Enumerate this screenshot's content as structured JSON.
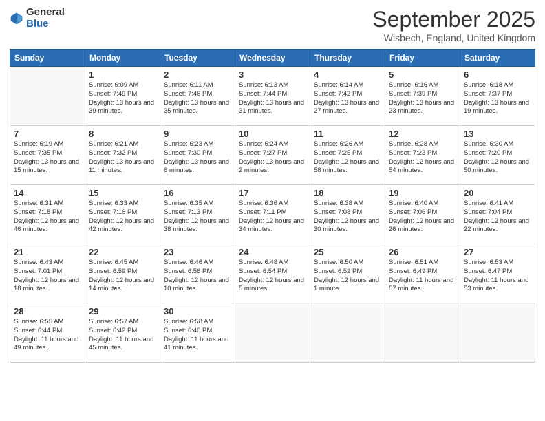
{
  "header": {
    "logo_general": "General",
    "logo_blue": "Blue",
    "month_title": "September 2025",
    "location": "Wisbech, England, United Kingdom"
  },
  "weekdays": [
    "Sunday",
    "Monday",
    "Tuesday",
    "Wednesday",
    "Thursday",
    "Friday",
    "Saturday"
  ],
  "weeks": [
    [
      {
        "day": "",
        "sunrise": "",
        "sunset": "",
        "daylight": ""
      },
      {
        "day": "1",
        "sunrise": "Sunrise: 6:09 AM",
        "sunset": "Sunset: 7:49 PM",
        "daylight": "Daylight: 13 hours and 39 minutes."
      },
      {
        "day": "2",
        "sunrise": "Sunrise: 6:11 AM",
        "sunset": "Sunset: 7:46 PM",
        "daylight": "Daylight: 13 hours and 35 minutes."
      },
      {
        "day": "3",
        "sunrise": "Sunrise: 6:13 AM",
        "sunset": "Sunset: 7:44 PM",
        "daylight": "Daylight: 13 hours and 31 minutes."
      },
      {
        "day": "4",
        "sunrise": "Sunrise: 6:14 AM",
        "sunset": "Sunset: 7:42 PM",
        "daylight": "Daylight: 13 hours and 27 minutes."
      },
      {
        "day": "5",
        "sunrise": "Sunrise: 6:16 AM",
        "sunset": "Sunset: 7:39 PM",
        "daylight": "Daylight: 13 hours and 23 minutes."
      },
      {
        "day": "6",
        "sunrise": "Sunrise: 6:18 AM",
        "sunset": "Sunset: 7:37 PM",
        "daylight": "Daylight: 13 hours and 19 minutes."
      }
    ],
    [
      {
        "day": "7",
        "sunrise": "Sunrise: 6:19 AM",
        "sunset": "Sunset: 7:35 PM",
        "daylight": "Daylight: 13 hours and 15 minutes."
      },
      {
        "day": "8",
        "sunrise": "Sunrise: 6:21 AM",
        "sunset": "Sunset: 7:32 PM",
        "daylight": "Daylight: 13 hours and 11 minutes."
      },
      {
        "day": "9",
        "sunrise": "Sunrise: 6:23 AM",
        "sunset": "Sunset: 7:30 PM",
        "daylight": "Daylight: 13 hours and 6 minutes."
      },
      {
        "day": "10",
        "sunrise": "Sunrise: 6:24 AM",
        "sunset": "Sunset: 7:27 PM",
        "daylight": "Daylight: 13 hours and 2 minutes."
      },
      {
        "day": "11",
        "sunrise": "Sunrise: 6:26 AM",
        "sunset": "Sunset: 7:25 PM",
        "daylight": "Daylight: 12 hours and 58 minutes."
      },
      {
        "day": "12",
        "sunrise": "Sunrise: 6:28 AM",
        "sunset": "Sunset: 7:23 PM",
        "daylight": "Daylight: 12 hours and 54 minutes."
      },
      {
        "day": "13",
        "sunrise": "Sunrise: 6:30 AM",
        "sunset": "Sunset: 7:20 PM",
        "daylight": "Daylight: 12 hours and 50 minutes."
      }
    ],
    [
      {
        "day": "14",
        "sunrise": "Sunrise: 6:31 AM",
        "sunset": "Sunset: 7:18 PM",
        "daylight": "Daylight: 12 hours and 46 minutes."
      },
      {
        "day": "15",
        "sunrise": "Sunrise: 6:33 AM",
        "sunset": "Sunset: 7:16 PM",
        "daylight": "Daylight: 12 hours and 42 minutes."
      },
      {
        "day": "16",
        "sunrise": "Sunrise: 6:35 AM",
        "sunset": "Sunset: 7:13 PM",
        "daylight": "Daylight: 12 hours and 38 minutes."
      },
      {
        "day": "17",
        "sunrise": "Sunrise: 6:36 AM",
        "sunset": "Sunset: 7:11 PM",
        "daylight": "Daylight: 12 hours and 34 minutes."
      },
      {
        "day": "18",
        "sunrise": "Sunrise: 6:38 AM",
        "sunset": "Sunset: 7:08 PM",
        "daylight": "Daylight: 12 hours and 30 minutes."
      },
      {
        "day": "19",
        "sunrise": "Sunrise: 6:40 AM",
        "sunset": "Sunset: 7:06 PM",
        "daylight": "Daylight: 12 hours and 26 minutes."
      },
      {
        "day": "20",
        "sunrise": "Sunrise: 6:41 AM",
        "sunset": "Sunset: 7:04 PM",
        "daylight": "Daylight: 12 hours and 22 minutes."
      }
    ],
    [
      {
        "day": "21",
        "sunrise": "Sunrise: 6:43 AM",
        "sunset": "Sunset: 7:01 PM",
        "daylight": "Daylight: 12 hours and 18 minutes."
      },
      {
        "day": "22",
        "sunrise": "Sunrise: 6:45 AM",
        "sunset": "Sunset: 6:59 PM",
        "daylight": "Daylight: 12 hours and 14 minutes."
      },
      {
        "day": "23",
        "sunrise": "Sunrise: 6:46 AM",
        "sunset": "Sunset: 6:56 PM",
        "daylight": "Daylight: 12 hours and 10 minutes."
      },
      {
        "day": "24",
        "sunrise": "Sunrise: 6:48 AM",
        "sunset": "Sunset: 6:54 PM",
        "daylight": "Daylight: 12 hours and 5 minutes."
      },
      {
        "day": "25",
        "sunrise": "Sunrise: 6:50 AM",
        "sunset": "Sunset: 6:52 PM",
        "daylight": "Daylight: 12 hours and 1 minute."
      },
      {
        "day": "26",
        "sunrise": "Sunrise: 6:51 AM",
        "sunset": "Sunset: 6:49 PM",
        "daylight": "Daylight: 11 hours and 57 minutes."
      },
      {
        "day": "27",
        "sunrise": "Sunrise: 6:53 AM",
        "sunset": "Sunset: 6:47 PM",
        "daylight": "Daylight: 11 hours and 53 minutes."
      }
    ],
    [
      {
        "day": "28",
        "sunrise": "Sunrise: 6:55 AM",
        "sunset": "Sunset: 6:44 PM",
        "daylight": "Daylight: 11 hours and 49 minutes."
      },
      {
        "day": "29",
        "sunrise": "Sunrise: 6:57 AM",
        "sunset": "Sunset: 6:42 PM",
        "daylight": "Daylight: 11 hours and 45 minutes."
      },
      {
        "day": "30",
        "sunrise": "Sunrise: 6:58 AM",
        "sunset": "Sunset: 6:40 PM",
        "daylight": "Daylight: 11 hours and 41 minutes."
      },
      {
        "day": "",
        "sunrise": "",
        "sunset": "",
        "daylight": ""
      },
      {
        "day": "",
        "sunrise": "",
        "sunset": "",
        "daylight": ""
      },
      {
        "day": "",
        "sunrise": "",
        "sunset": "",
        "daylight": ""
      },
      {
        "day": "",
        "sunrise": "",
        "sunset": "",
        "daylight": ""
      }
    ]
  ]
}
